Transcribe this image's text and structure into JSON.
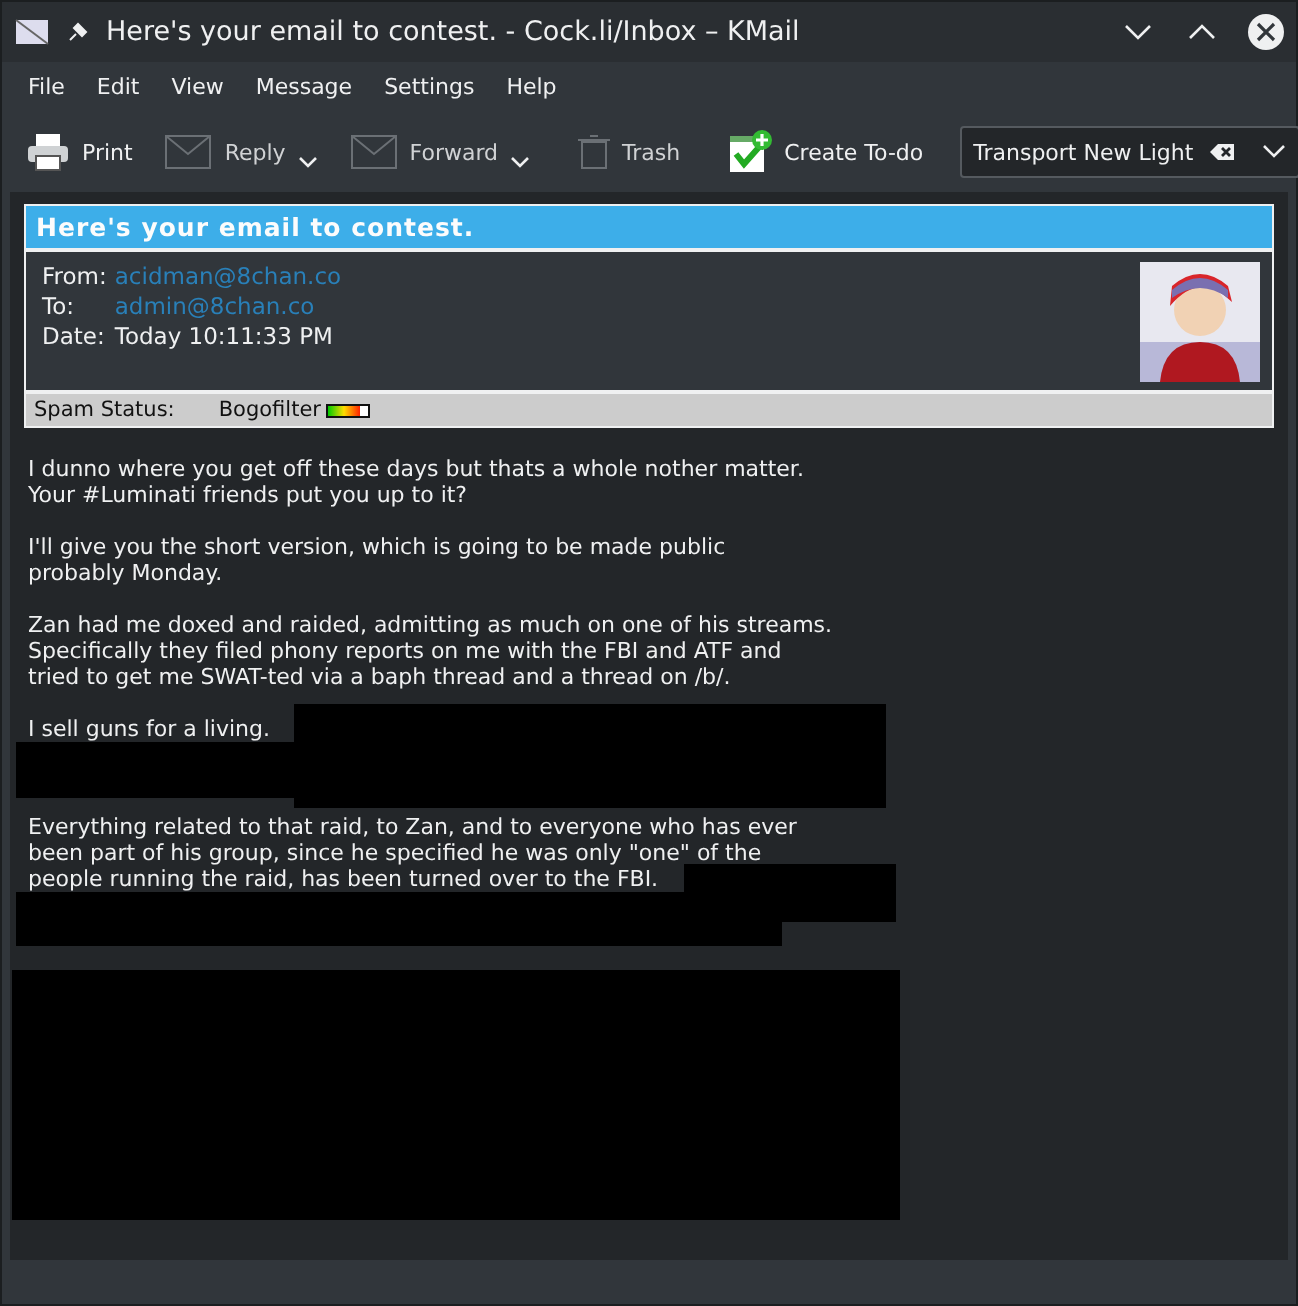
{
  "window": {
    "title": "Here's your email to contest. - Cock.li/Inbox – KMail"
  },
  "menu": [
    "File",
    "Edit",
    "View",
    "Message",
    "Settings",
    "Help"
  ],
  "toolbar": [
    {
      "kind": "button",
      "label": "Print",
      "dropdown": false,
      "disabled": false
    },
    {
      "kind": "button",
      "label": "Reply",
      "dropdown": true,
      "disabled": true
    },
    {
      "kind": "button",
      "label": "Forward",
      "dropdown": true,
      "disabled": true
    },
    {
      "kind": "button",
      "label": "Trash",
      "dropdown": false,
      "disabled": true
    },
    {
      "kind": "button",
      "label": "Create To-do",
      "dropdown": false,
      "disabled": false
    },
    {
      "kind": "combo",
      "label": "Transport New Light"
    }
  ],
  "message": {
    "subject": "Here's your email to contest.",
    "fields": [
      {
        "label": "From:",
        "value": "acidman@8chan.co",
        "kind": "link"
      },
      {
        "label": "To:",
        "value": "admin@8chan.co",
        "kind": "link"
      },
      {
        "label": "Date:",
        "value": "Today 10:11:33 PM",
        "kind": "text"
      }
    ],
    "spam": {
      "label": "Spam Status:",
      "agent": "Bogofilter",
      "level": 0.8
    }
  },
  "body": [
    "I dunno where you get off these days but thats a whole nother matter.\nYour #Luminati friends put you up to it?",
    "I'll give you the short version, which is going to be made public\nprobably Monday.",
    "Zan had me doxed and raided, admitting as much on one of his streams.\nSpecifically they filed phony reports on me with the FBI and ATF and\ntried to get me SWAT-ted via a baph thread and a thread on /b/.",
    "I sell guns for a living.",
    "Everything related to that raid, to Zan, and to everyone who has ever\nbeen part of his group, since he specified he was only \"one\" of the\npeople running the raid, has been turned over to the FBI."
  ]
}
